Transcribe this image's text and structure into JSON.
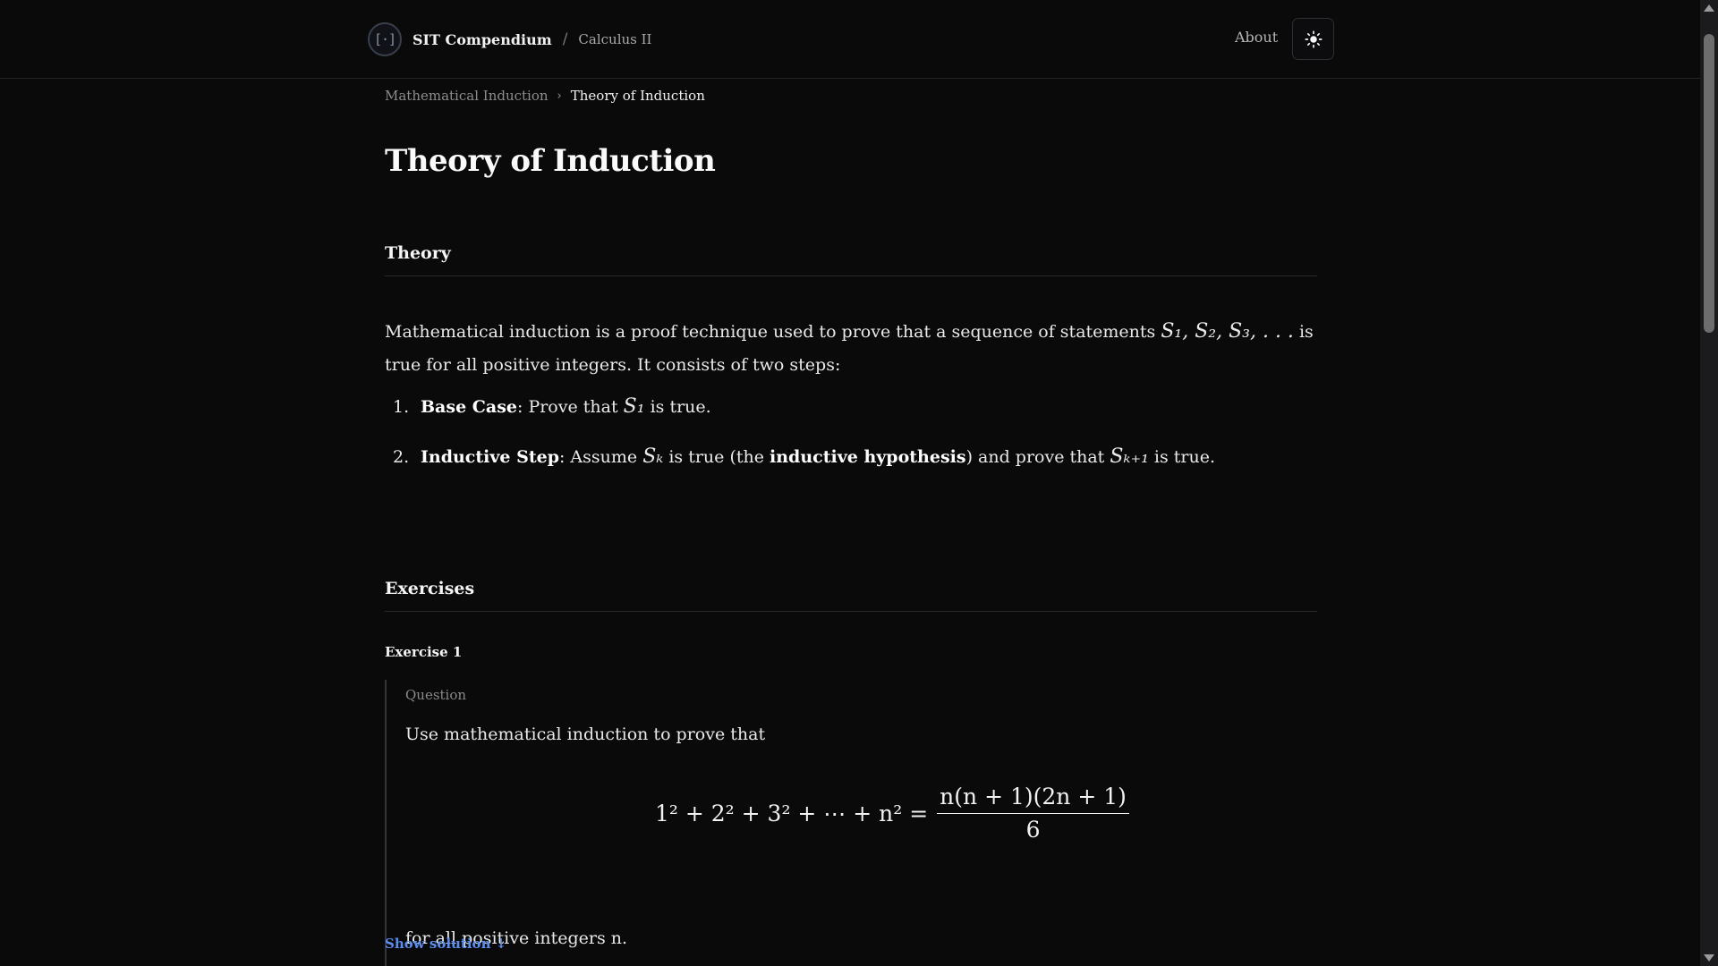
{
  "header": {
    "logo_glyph": "[·]",
    "brand": "SIT Compendium",
    "separator": "/",
    "course": "Calculus II",
    "about": "About",
    "theme_toggle_icon": "sun-icon"
  },
  "breadcrumb": {
    "parent": "Mathematical Induction",
    "separator": "›",
    "current": "Theory of Induction"
  },
  "page": {
    "title": "Theory of Induction"
  },
  "theory": {
    "heading": "Theory",
    "intro_part1": "Mathematical induction is a proof technique used to prove that a sequence of statements ",
    "intro_math": "S₁, S₂, S₃, . . .",
    "intro_part2": " is true for all positive integers. It consists of two steps:",
    "steps": [
      {
        "number": "1.",
        "term": "Base Case",
        "text_before": ": Prove that ",
        "math": "S₁",
        "text_after": " is true."
      },
      {
        "number": "2.",
        "term": "Inductive Step",
        "text_before": ": Assume ",
        "math": "Sₖ",
        "text_middle": " is true (the ",
        "emphasis": "inductive hypothesis",
        "text_middle2": ") and prove that ",
        "math2": "Sₖ₊₁",
        "text_after": " is true."
      }
    ]
  },
  "exercises": {
    "heading": "Exercises",
    "items": [
      {
        "label": "Exercise 1",
        "question_label": "Question",
        "question_text": "Use mathematical induction to prove that",
        "equation_lhs": "1² + 2² + 3² + ⋯ + n² =",
        "equation_numerator": "n(n + 1)(2n + 1)",
        "equation_denominator": "6",
        "question_foot": "for all positive integers n.",
        "show_solution": "Show solution ↓"
      }
    ]
  }
}
